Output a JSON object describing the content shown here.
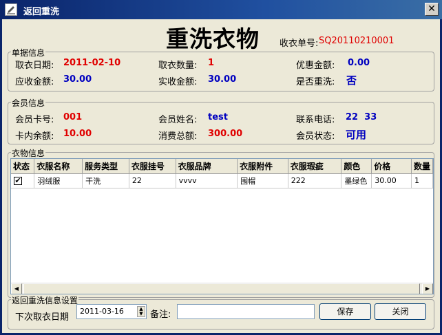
{
  "window": {
    "title": "返回重洗",
    "close_label": "✕"
  },
  "header": {
    "big_title": "重洗衣物",
    "order_label": "收衣单号:",
    "order_value": "SQ20110210001"
  },
  "receipt": {
    "legend": "单据信息",
    "pickup_date_label": "取衣日期:",
    "pickup_date": "2011-02-10",
    "count_label": "取衣数量:",
    "count": "1",
    "discount_label": "优惠金额:",
    "discount": "0.00",
    "due_label": "应收金额:",
    "due": "30.00",
    "paid_label": "实收金额:",
    "paid": "30.00",
    "rewash_label": "是否重洗:",
    "rewash": "否"
  },
  "member": {
    "legend": "会员信息",
    "card_label": "会员卡号:",
    "card": "001",
    "name_label": "会员姓名:",
    "name": "test",
    "phone_label": "联系电话:",
    "phone": "22  33",
    "balance_label": "卡内余额:",
    "balance": "10.00",
    "total_label": "消费总额:",
    "total": "300.00",
    "status_label": "会员状态:",
    "status": "可用"
  },
  "clothes": {
    "legend": "衣物信息",
    "columns": [
      "状态",
      "衣服名称",
      "服务类型",
      "衣服挂号",
      "衣服品牌",
      "衣服附件",
      "衣服瑕疵",
      "颜色",
      "价格",
      "数量"
    ],
    "rows": [
      {
        "checked": "✔",
        "cells": [
          "羽绒服",
          "干洗",
          "22",
          "vvvv",
          "围帽",
          "222",
          "墨绿色",
          "30.00",
          "1"
        ]
      }
    ],
    "scroll_left": "◀",
    "scroll_right": "▶"
  },
  "settings": {
    "legend": "返回重洗信息设置",
    "next_date_label": "下次取衣日期",
    "next_date": "2011-03-16",
    "note_label": "备注:",
    "note": "",
    "save_label": "保存",
    "close_label": "关闭"
  }
}
